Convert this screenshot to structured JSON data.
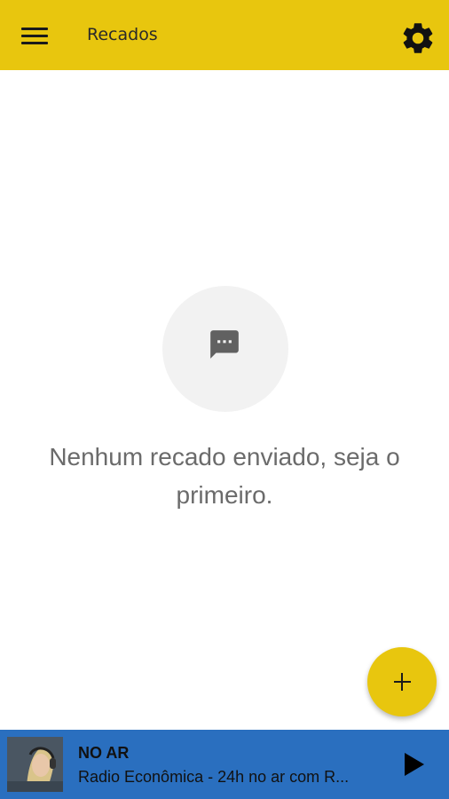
{
  "appbar": {
    "title": "Recados",
    "menu_icon": "hamburger-menu-icon",
    "settings_icon": "gear-icon",
    "background": "#e8c60e"
  },
  "empty_state": {
    "icon": "chat-bubble-icon",
    "message": "Nenhum recado enviado, seja o primeiro."
  },
  "fab": {
    "icon": "plus-icon",
    "color": "#e8c60e"
  },
  "player": {
    "status": "NO AR",
    "station": "Radio Econômica - 24h no ar com R...",
    "play_icon": "play-icon",
    "background": "#2a6fbf"
  }
}
